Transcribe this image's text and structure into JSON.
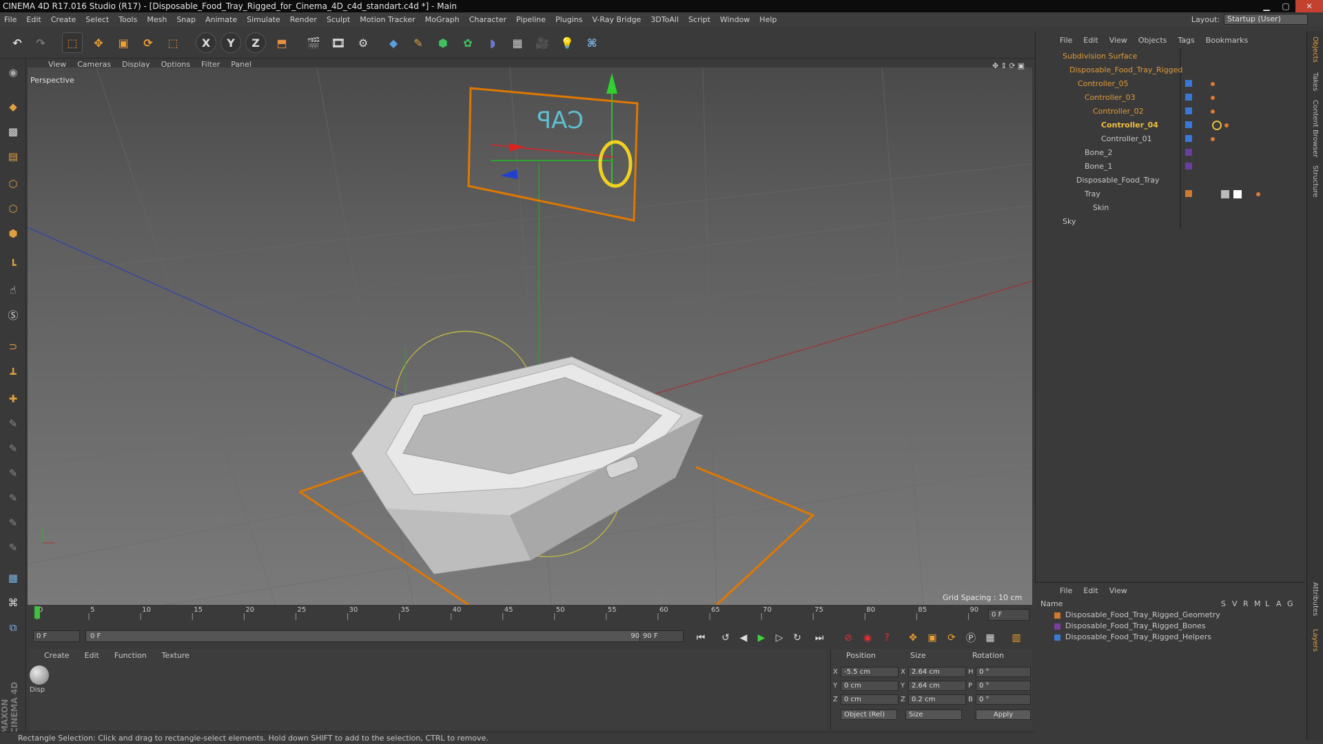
{
  "window": {
    "title": "CINEMA 4D R17.016 Studio (R17) - [Disposable_Food_Tray_Rigged_for_Cinema_4D_c4d_standart.c4d *] - Main"
  },
  "menubar": [
    "File",
    "Edit",
    "Create",
    "Select",
    "Tools",
    "Mesh",
    "Snap",
    "Animate",
    "Simulate",
    "Render",
    "Sculpt",
    "Motion Tracker",
    "MoGraph",
    "Character",
    "Pipeline",
    "Plugins",
    "V-Ray Bridge",
    "3DToAll",
    "Script",
    "Window",
    "Help"
  ],
  "layout": {
    "label": "Layout:",
    "value": "Startup (User)"
  },
  "viewport": {
    "menu": [
      "View",
      "Cameras",
      "Display",
      "Options",
      "Filter",
      "Panel"
    ],
    "name": "Perspective",
    "grid_spacing": "Grid Spacing : 10 cm",
    "gizmo_label": "CAP"
  },
  "timeline": {
    "ticks": [
      "0",
      "5",
      "10",
      "15",
      "20",
      "25",
      "30",
      "35",
      "40",
      "45",
      "50",
      "55",
      "60",
      "65",
      "70",
      "75",
      "80",
      "85",
      "90"
    ],
    "current_frame_right": "0 F",
    "start_frame": "0 F",
    "range_start": "0 F",
    "range_end": "90 F",
    "end_frame": "90 F"
  },
  "material_manager": {
    "menu": [
      "Create",
      "Edit",
      "Function",
      "Texture"
    ],
    "material_name": "Disp"
  },
  "coordinates": {
    "headers": [
      "Position",
      "Size",
      "Rotation"
    ],
    "rows": [
      {
        "axis": "X",
        "pos": "-5.5 cm",
        "size_axis": "X",
        "size": "2.64 cm",
        "rot_axis": "H",
        "rot": "0 °"
      },
      {
        "axis": "Y",
        "pos": "0 cm",
        "size_axis": "Y",
        "size": "2.64 cm",
        "rot_axis": "P",
        "rot": "0 °"
      },
      {
        "axis": "Z",
        "pos": "0 cm",
        "size_axis": "Z",
        "size": "0.2 cm",
        "rot_axis": "B",
        "rot": "0 °"
      }
    ],
    "mode": "Object (Rel)",
    "size_mode": "Size",
    "apply": "Apply"
  },
  "status": "Rectangle Selection: Click and drag to rectangle-select elements. Hold down SHIFT to add to the selection, CTRL to remove.",
  "object_manager": {
    "menu": [
      "File",
      "Edit",
      "View",
      "Objects",
      "Tags",
      "Bookmarks"
    ],
    "objects": [
      {
        "name": "Subdivision Surface",
        "color": "#e09a3c"
      },
      {
        "name": "Disposable_Food_Tray_Rigged",
        "color": "#e09a3c"
      },
      {
        "name": "Controller_05",
        "color": "#e09a3c"
      },
      {
        "name": "Controller_03",
        "color": "#e09a3c"
      },
      {
        "name": "Controller_02",
        "color": "#e09a3c"
      },
      {
        "name": "Controller_04",
        "color": "#f0c040"
      },
      {
        "name": "Controller_01",
        "color": "#d0d0d0"
      },
      {
        "name": "Bone_2",
        "color": "#d0d0d0"
      },
      {
        "name": "Bone_1",
        "color": "#d0d0d0"
      },
      {
        "name": "Disposable_Food_Tray",
        "color": "#d0d0d0"
      },
      {
        "name": "Tray",
        "color": "#d0d0d0"
      },
      {
        "name": "Skin",
        "color": "#d0d0d0"
      },
      {
        "name": "Sky",
        "color": "#d0d0d0"
      }
    ]
  },
  "layer_manager": {
    "menu": [
      "File",
      "Edit",
      "View"
    ],
    "header_name": "Name",
    "header_cols": [
      "S",
      "V",
      "R",
      "M",
      "L",
      "A",
      "G"
    ],
    "layers": [
      {
        "name": "Disposable_Food_Tray_Rigged_Geometry",
        "color": "#d07a30"
      },
      {
        "name": "Disposable_Food_Tray_Rigged_Bones",
        "color": "#7a3ea0"
      },
      {
        "name": "Disposable_Food_Tray_Rigged_Helpers",
        "color": "#3a7ad0"
      }
    ]
  },
  "side_tabs": [
    "Objects",
    "Takes",
    "Content Browser",
    "Structure",
    "Attributes",
    "Layers"
  ],
  "brand": "MAXON CINEMA 4D"
}
